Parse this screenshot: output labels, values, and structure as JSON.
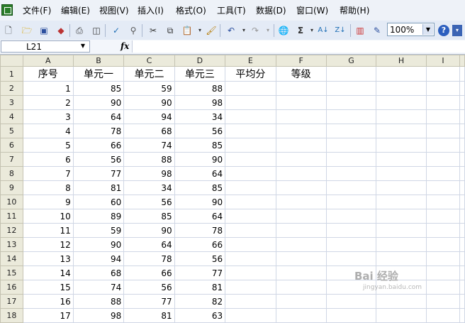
{
  "menu": [
    "文件(F)",
    "编辑(E)",
    "视图(V)",
    "插入(I)",
    "格式(O)",
    "工具(T)",
    "数据(D)",
    "窗口(W)",
    "帮助(H)"
  ],
  "toolbar": {
    "zoom": "100%"
  },
  "formula": {
    "cell_ref": "L21",
    "fx_label": "fx",
    "content": ""
  },
  "columns": [
    "A",
    "B",
    "C",
    "D",
    "E",
    "F",
    "G",
    "H",
    "I"
  ],
  "headers": [
    "序号",
    "单元一",
    "单元二",
    "单元三",
    "平均分",
    "等级"
  ],
  "rows": [
    [
      1,
      85,
      59,
      88
    ],
    [
      2,
      90,
      90,
      98
    ],
    [
      3,
      64,
      94,
      34
    ],
    [
      4,
      78,
      68,
      56
    ],
    [
      5,
      66,
      74,
      85
    ],
    [
      6,
      56,
      88,
      90
    ],
    [
      7,
      77,
      98,
      64
    ],
    [
      8,
      81,
      34,
      85
    ],
    [
      9,
      60,
      56,
      90
    ],
    [
      10,
      89,
      85,
      64
    ],
    [
      11,
      59,
      90,
      78
    ],
    [
      12,
      90,
      64,
      66
    ],
    [
      13,
      94,
      78,
      56
    ],
    [
      14,
      68,
      66,
      77
    ],
    [
      15,
      74,
      56,
      81
    ],
    [
      16,
      88,
      77,
      82
    ],
    [
      17,
      98,
      81,
      63
    ]
  ],
  "watermark": {
    "brand": "Bai 经验",
    "sub": "jingyan.baidu.com"
  }
}
